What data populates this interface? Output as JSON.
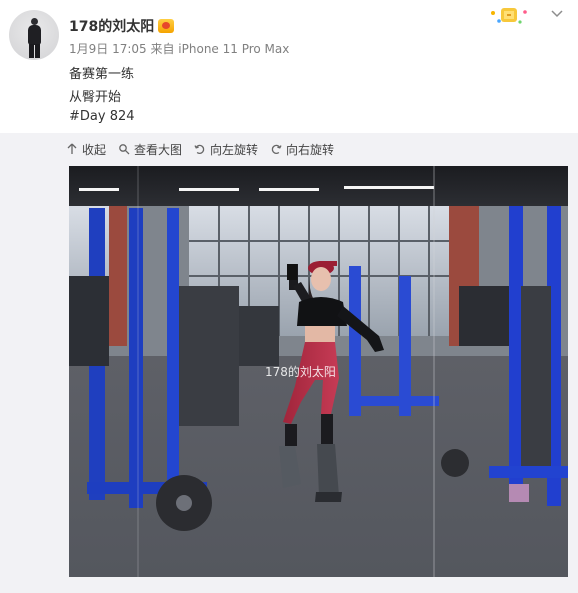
{
  "post": {
    "username": "178的刘太阳",
    "meta": "1月9日 17:05 来自 iPhone 11 Pro Max",
    "lines": [
      "备赛第一练",
      "从臀开始",
      "#Day 824"
    ]
  },
  "toolbar": {
    "collapse": "收起",
    "view_large": "查看大图",
    "rotate_left": "向左旋转",
    "rotate_right": "向右旋转"
  },
  "image": {
    "watermark": "178的刘太阳"
  },
  "colors": {
    "panel": "#f2f2f5",
    "link": "#eb7350"
  }
}
